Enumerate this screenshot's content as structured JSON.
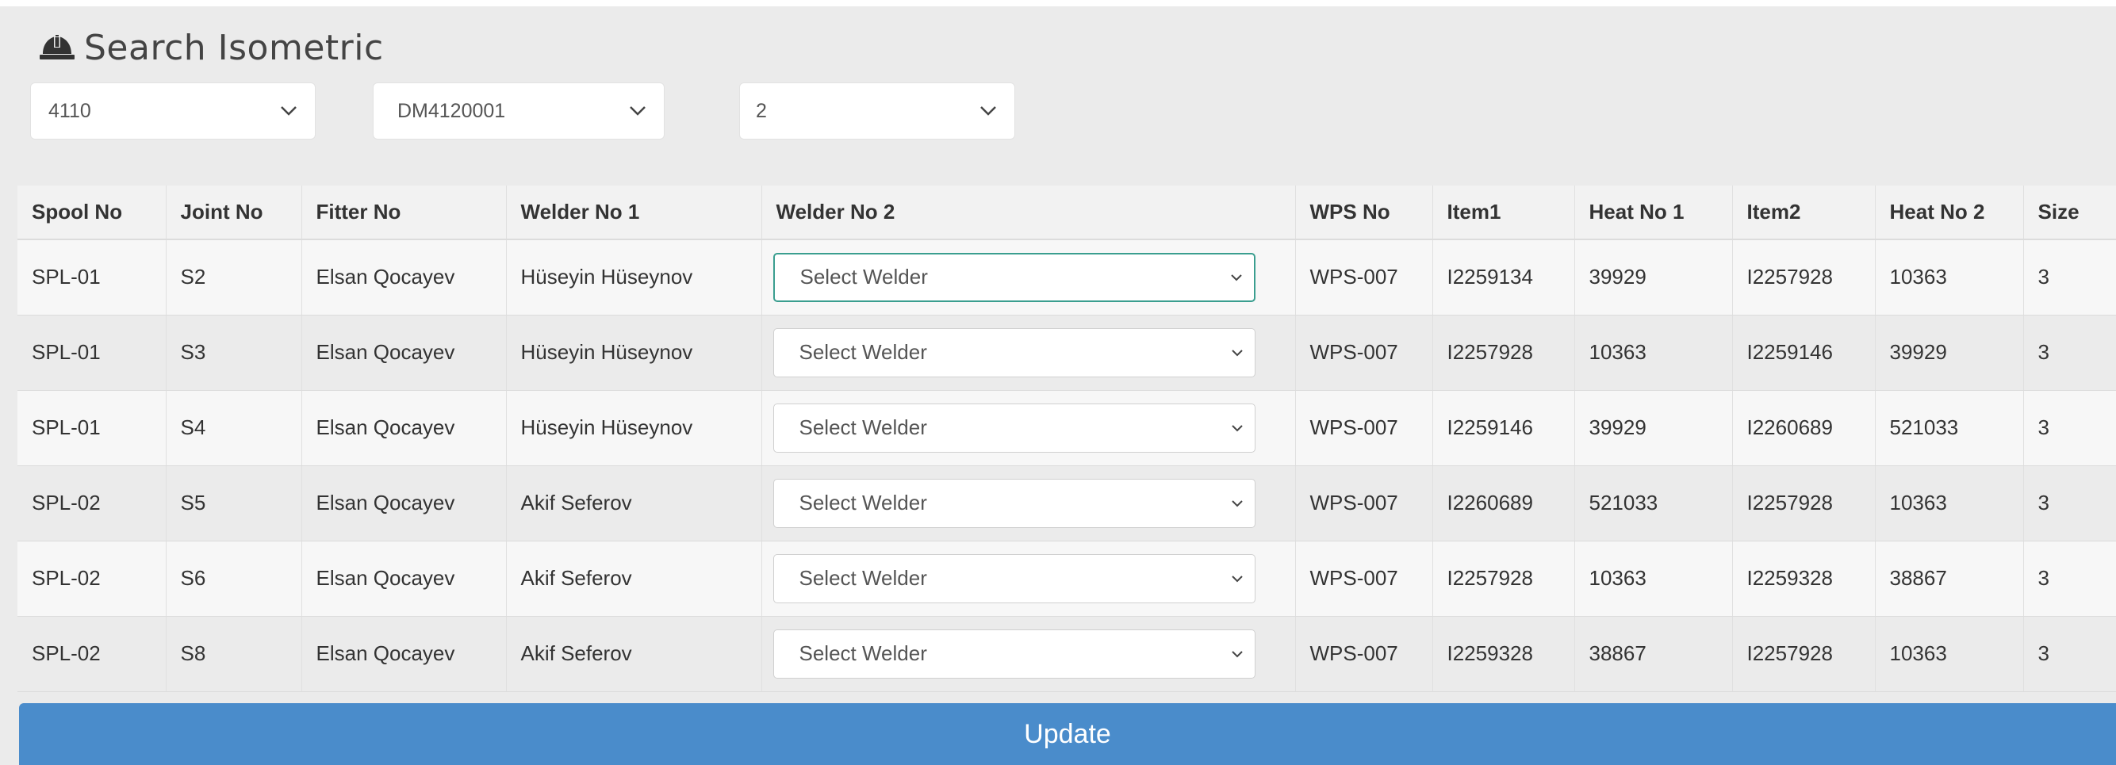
{
  "header": {
    "title": "Search Isometric",
    "icon": "hard-hat-icon"
  },
  "filters": [
    {
      "value": "4110"
    },
    {
      "value": "DM4120001"
    },
    {
      "value": "2"
    }
  ],
  "table": {
    "columns": [
      "Spool No",
      "Joint No",
      "Fitter No",
      "Welder No 1",
      "Welder No 2",
      "WPS No",
      "Item1",
      "Heat No 1",
      "Item2",
      "Heat No 2",
      "Size"
    ],
    "rows": [
      {
        "spool": "SPL-01",
        "joint": "S2",
        "fitter": "Elsan Qocayev",
        "welder1": "Hüseyin Hüseynov",
        "welder2": "Select Welder",
        "wps": "WPS-007",
        "item1": "I2259134",
        "heat1": "39929",
        "item2": "I2257928",
        "heat2": "10363",
        "size": "3"
      },
      {
        "spool": "SPL-01",
        "joint": "S3",
        "fitter": "Elsan Qocayev",
        "welder1": "Hüseyin Hüseynov",
        "welder2": "Select Welder",
        "wps": "WPS-007",
        "item1": "I2257928",
        "heat1": "10363",
        "item2": "I2259146",
        "heat2": "39929",
        "size": "3"
      },
      {
        "spool": "SPL-01",
        "joint": "S4",
        "fitter": "Elsan Qocayev",
        "welder1": "Hüseyin Hüseynov",
        "welder2": "Select Welder",
        "wps": "WPS-007",
        "item1": "I2259146",
        "heat1": "39929",
        "item2": "I2260689",
        "heat2": "521033",
        "size": "3"
      },
      {
        "spool": "SPL-02",
        "joint": "S5",
        "fitter": "Elsan Qocayev",
        "welder1": "Akif Seferov",
        "welder2": "Select Welder",
        "wps": "WPS-007",
        "item1": "I2260689",
        "heat1": "521033",
        "item2": "I2257928",
        "heat2": "10363",
        "size": "3"
      },
      {
        "spool": "SPL-02",
        "joint": "S6",
        "fitter": "Elsan Qocayev",
        "welder1": "Akif Seferov",
        "welder2": "Select Welder",
        "wps": "WPS-007",
        "item1": "I2257928",
        "heat1": "10363",
        "item2": "I2259328",
        "heat2": "38867",
        "size": "3"
      },
      {
        "spool": "SPL-02",
        "joint": "S8",
        "fitter": "Elsan Qocayev",
        "welder1": "Akif Seferov",
        "welder2": "Select Welder",
        "wps": "WPS-007",
        "item1": "I2259328",
        "heat1": "38867",
        "item2": "I2257928",
        "heat2": "10363",
        "size": "3"
      }
    ]
  },
  "update_button": {
    "label": "Update"
  },
  "colors": {
    "panel_bg": "#ebebeb",
    "button_blue": "#4a8ccb",
    "focus_teal": "#3a9e8f"
  }
}
